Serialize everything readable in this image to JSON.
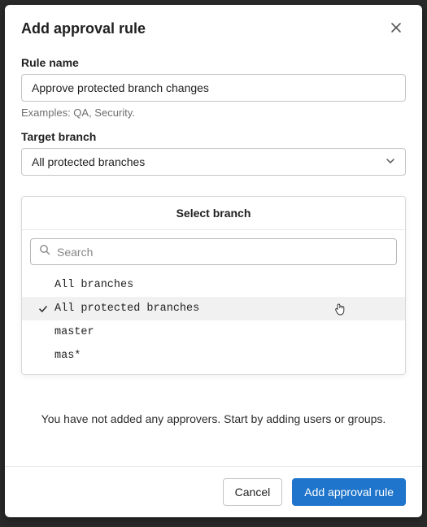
{
  "modal": {
    "title": "Add approval rule"
  },
  "ruleName": {
    "label": "Rule name",
    "value": "Approve protected branch changes",
    "helper": "Examples: QA, Security."
  },
  "targetBranch": {
    "label": "Target branch",
    "selected": "All protected branches"
  },
  "dropdown": {
    "header": "Select branch",
    "searchPlaceholder": "Search",
    "options": [
      {
        "label": "All branches",
        "selected": false
      },
      {
        "label": "All protected branches",
        "selected": true
      },
      {
        "label": "master",
        "selected": false
      },
      {
        "label": "mas*",
        "selected": false
      }
    ]
  },
  "approvers": {
    "emptyText": "You have not added any approvers. Start by adding users or groups."
  },
  "footer": {
    "cancel": "Cancel",
    "submit": "Add approval rule"
  }
}
